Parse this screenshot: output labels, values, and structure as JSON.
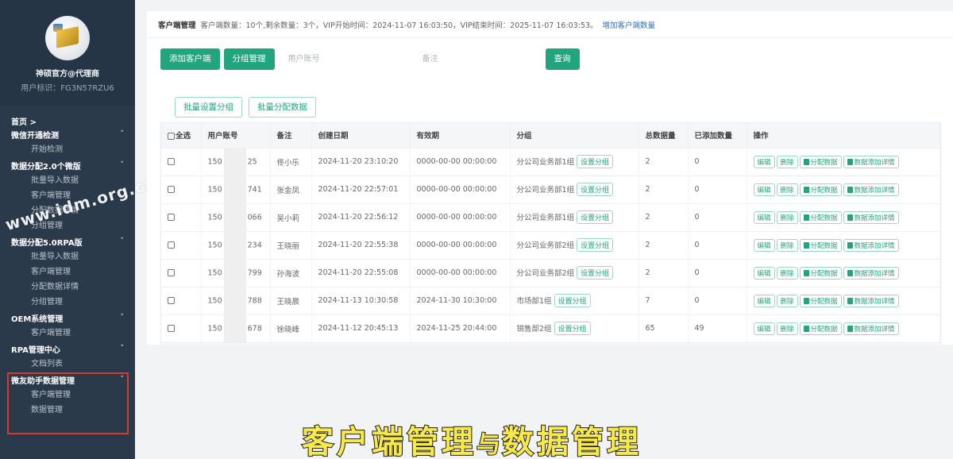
{
  "sidebar": {
    "profile": {
      "name": "神硕官方@代理商",
      "uid": "用户标识：FG3N57RZU6"
    },
    "home": "首页 >",
    "groups": [
      {
        "label": "微信开通检测",
        "items": [
          "开始检测"
        ]
      },
      {
        "label": "数据分配2.0个微版",
        "items": [
          "批量导入数据",
          "客户端管理",
          "分配数据详情",
          "分组管理"
        ]
      },
      {
        "label": "数据分配5.0RPA版",
        "items": [
          "批量导入数据",
          "客户端管理",
          "分配数据详情",
          "分组管理"
        ]
      },
      {
        "label": "OEM系统管理",
        "items": [
          "客户端管理"
        ]
      },
      {
        "label": "RPA管理中心",
        "items": [
          "文档列表"
        ]
      },
      {
        "label": "微友助手数据管理",
        "items": [
          "客户端管理",
          "数据管理"
        ]
      }
    ],
    "chevron": "˅"
  },
  "watermark": "www.idm.org.cn",
  "header": {
    "title": "客户端管理",
    "info": "客户端数量：10个,剩余数量：3个，VIP开始时间：2024-11-07 16:03:50，VIP结束时间：2025-11-07 16:03:53。",
    "link": "增加客户端数量"
  },
  "toolbar": {
    "add_client": "添加客户端",
    "group_manage": "分组管理",
    "account_placeholder": "用户账号",
    "remark_placeholder": "备注",
    "query": "查询"
  },
  "batch": {
    "set_group": "批量设置分组",
    "assign_data": "批量分配数据"
  },
  "table": {
    "headers": [
      "全选",
      "用户账号",
      "备注",
      "创建日期",
      "有效期",
      "分组",
      "总数据量",
      "已添加数量",
      "操作"
    ],
    "set_group_label": "设置分组",
    "actions": [
      "编辑",
      "删除",
      "分配数据",
      "数据添加详情"
    ],
    "rows": [
      {
        "acct_pre": "150",
        "acct_suf": "25",
        "remark": "佟小乐",
        "created": "2024-11-20 23:10:20",
        "valid": "0000-00-00 00:00:00",
        "group": "分公司业务部1组",
        "total": "2",
        "added": "0"
      },
      {
        "acct_pre": "150",
        "acct_suf": "741",
        "remark": "张金凤",
        "created": "2024-11-20 22:57:01",
        "valid": "0000-00-00 00:00:00",
        "group": "分公司业务部1组",
        "total": "2",
        "added": "0"
      },
      {
        "acct_pre": "150",
        "acct_suf": "066",
        "remark": "吴小莉",
        "created": "2024-11-20 22:56:12",
        "valid": "0000-00-00 00:00:00",
        "group": "分公司业务部1组",
        "total": "2",
        "added": "0"
      },
      {
        "acct_pre": "150",
        "acct_suf": "234",
        "remark": "王晓丽",
        "created": "2024-11-20 22:55:38",
        "valid": "0000-00-00 00:00:00",
        "group": "分公司业务部2组",
        "total": "2",
        "added": "0"
      },
      {
        "acct_pre": "150",
        "acct_suf": "799",
        "remark": "孙海波",
        "created": "2024-11-20 22:55:08",
        "valid": "0000-00-00 00:00:00",
        "group": "分公司业务部2组",
        "total": "2",
        "added": "0"
      },
      {
        "acct_pre": "150",
        "acct_suf": "788",
        "remark": "王晓晨",
        "created": "2024-11-13 10:30:58",
        "valid": "2024-11-30 10:30:00",
        "group": "市场部1组",
        "total": "7",
        "added": "0"
      },
      {
        "acct_pre": "150",
        "acct_suf": "678",
        "remark": "徐晓峰",
        "created": "2024-11-12 20:45:13",
        "valid": "2024-11-25 20:44:00",
        "group": "销售部2组",
        "total": "65",
        "added": "49"
      }
    ]
  },
  "caption": {
    "part1": "客户端管理",
    "part2": "与",
    "part3": "数据管理"
  },
  "colors": {
    "primary": "#22a47e",
    "sidebar": "#2a3a4b",
    "highlight": "#d63b2f",
    "caption": "#f7e94a"
  }
}
